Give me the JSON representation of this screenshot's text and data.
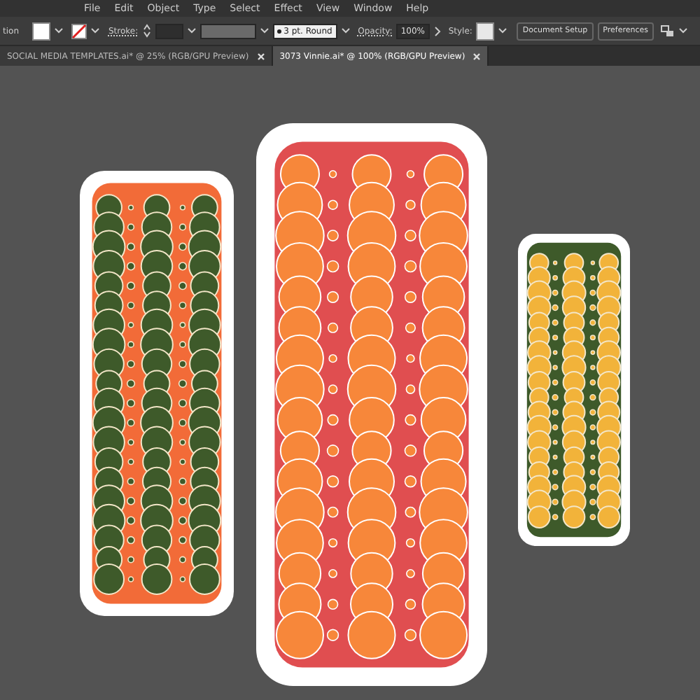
{
  "menu_bar": {
    "items": [
      "File",
      "Edit",
      "Object",
      "Type",
      "Select",
      "Effect",
      "View",
      "Window",
      "Help"
    ]
  },
  "control_bar": {
    "tool_label": "tion",
    "stroke_label": "Stroke:",
    "brush": "3 pt. Round",
    "opacity_label": "Opacity:",
    "opacity": "100%",
    "style_label": "Style:",
    "buttons": [
      "Document Setup",
      "Preferences"
    ]
  },
  "tabs": [
    {
      "label": "SOCIAL MEDIA TEMPLATES.ai* @ 25% (RGB/GPU Preview)",
      "selected": false
    },
    {
      "label": "3073 Vinnie.ai* @ 100% (RGB/GPU Preview)",
      "selected": true
    }
  ]
}
